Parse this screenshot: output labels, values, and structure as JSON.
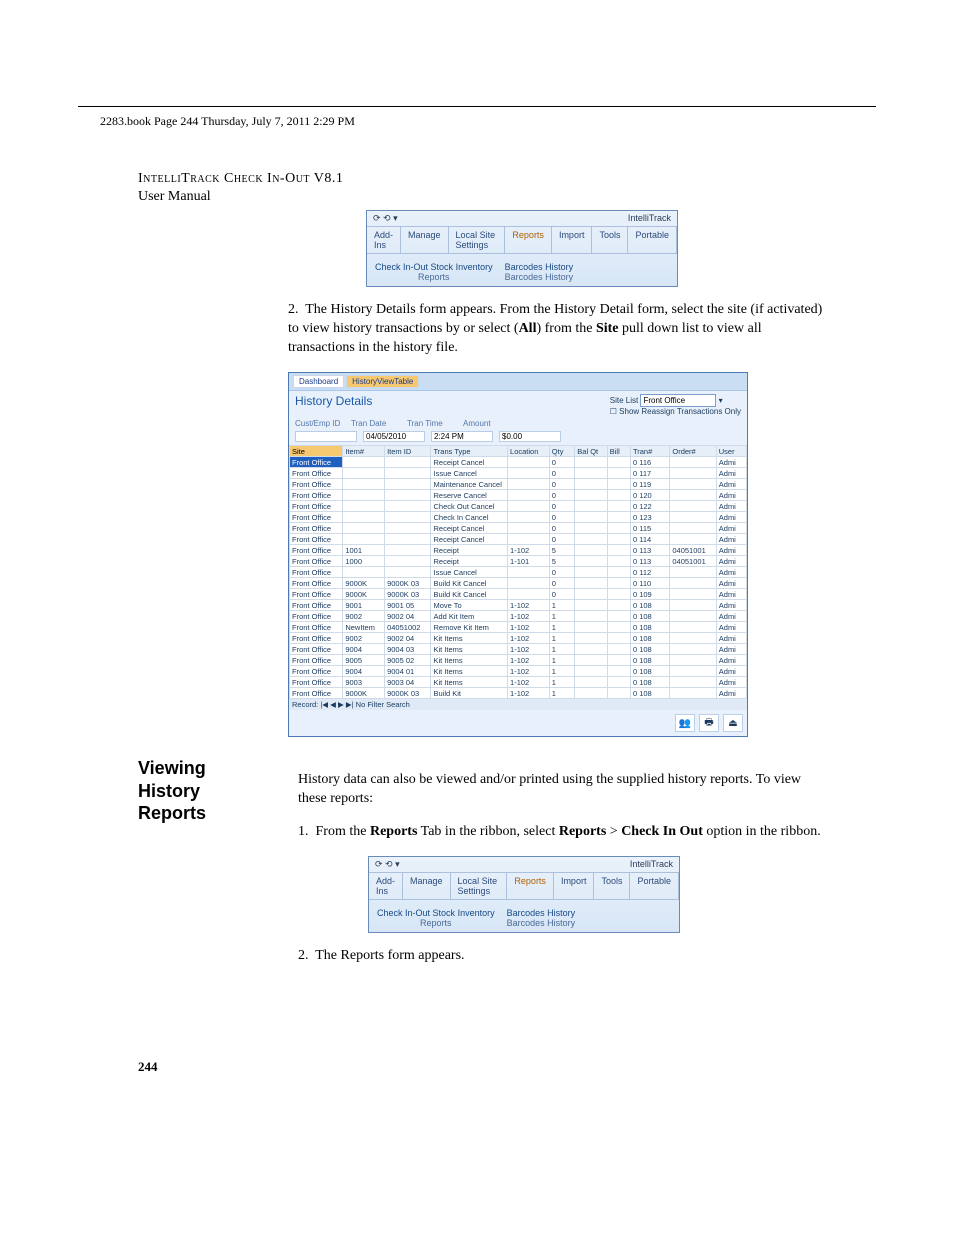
{
  "meta": {
    "book_line": "2283.book  Page 244  Thursday, July 7, 2011  2:29 PM"
  },
  "header": {
    "product": "IntelliTrack Check In-Out V8.1",
    "subtitle": "User Manual"
  },
  "page_number": "244",
  "ribbon": {
    "app_title": "IntelliTrack",
    "tabs": [
      "Add-Ins",
      "Manage",
      "Local Site Settings",
      "Reports",
      "Import",
      "Tools",
      "Portable"
    ],
    "groups": {
      "g1": [
        "Check In-Out",
        "Stock",
        "Inventory"
      ],
      "g2": [
        "Barcodes",
        "History"
      ],
      "g3": [
        "Reports"
      ],
      "g4": [
        "Barcodes",
        "History"
      ]
    }
  },
  "step2a": {
    "num": "2.",
    "text_before": "The History Details form appears. From the History Detail form, select the site (if activated) to view history transactions by or select (",
    "all_word": "All",
    "text_mid": ") from the ",
    "site_word": "Site",
    "text_after": " pull down list to view all transactions in the history file."
  },
  "history_form": {
    "tab1": "Dashboard",
    "tab2": "HistoryViewTable",
    "title": "History Details",
    "site_list_label": "Site List",
    "site_list_value": "Front Office",
    "show_reassign": "Show Reassign Transactions Only",
    "fields": {
      "cust": "Cust/Emp ID",
      "trandate": "Tran Date",
      "trandate_v": "04/05/2010",
      "trantime": "Tran Time",
      "trantime_v": "2:24 PM",
      "amount": "Amount",
      "amount_v": "$0.00"
    },
    "columns": [
      "Site",
      "Item#",
      "Item ID",
      "Trans Type",
      "Location",
      "Qty",
      "Bal Qt",
      "Bill",
      "Tran#",
      "Order#",
      "User"
    ],
    "rows": [
      [
        "Front Office",
        "",
        "",
        "Receipt Cancel",
        "",
        "0",
        "",
        "",
        "0 116",
        "",
        "Admi"
      ],
      [
        "Front Office",
        "",
        "",
        "Issue Cancel",
        "",
        "0",
        "",
        "",
        "0 117",
        "",
        "Admi"
      ],
      [
        "Front Office",
        "",
        "",
        "Maintenance Cancel",
        "",
        "0",
        "",
        "",
        "0 119",
        "",
        "Admi"
      ],
      [
        "Front Office",
        "",
        "",
        "Reserve Cancel",
        "",
        "0",
        "",
        "",
        "0 120",
        "",
        "Admi"
      ],
      [
        "Front Office",
        "",
        "",
        "Check Out Cancel",
        "",
        "0",
        "",
        "",
        "0 122",
        "",
        "Admi"
      ],
      [
        "Front Office",
        "",
        "",
        "Check In Cancel",
        "",
        "0",
        "",
        "",
        "0 123",
        "",
        "Admi"
      ],
      [
        "Front Office",
        "",
        "",
        "Receipt Cancel",
        "",
        "0",
        "",
        "",
        "0 115",
        "",
        "Admi"
      ],
      [
        "Front Office",
        "",
        "",
        "Receipt Cancel",
        "",
        "0",
        "",
        "",
        "0 114",
        "",
        "Admi"
      ],
      [
        "Front Office",
        "1001",
        "",
        "Receipt",
        "1-102",
        "5",
        "",
        "",
        "0 113",
        "04051001",
        "Admi"
      ],
      [
        "Front Office",
        "1000",
        "",
        "Receipt",
        "1-101",
        "5",
        "",
        "",
        "0 113",
        "04051001",
        "Admi"
      ],
      [
        "Front Office",
        "",
        "",
        "Issue Cancel",
        "",
        "0",
        "",
        "",
        "0 112",
        "",
        "Admi"
      ],
      [
        "Front Office",
        "9000K",
        "9000K 03",
        "Build Kit Cancel",
        "",
        "0",
        "",
        "",
        "0 110",
        "",
        "Admi"
      ],
      [
        "Front Office",
        "9000K",
        "9000K 03",
        "Build Kit Cancel",
        "",
        "0",
        "",
        "",
        "0 109",
        "",
        "Admi"
      ],
      [
        "Front Office",
        "9001",
        "9001 05",
        "Move To",
        "1-102",
        "1",
        "",
        "",
        "0 108",
        "",
        "Admi"
      ],
      [
        "Front Office",
        "9002",
        "9002 04",
        "Add Kit Item",
        "1-102",
        "1",
        "",
        "",
        "0 108",
        "",
        "Admi"
      ],
      [
        "Front Office",
        "NewItem",
        "04051002",
        "Remove Kit Item",
        "1-102",
        "1",
        "",
        "",
        "0 108",
        "",
        "Admi"
      ],
      [
        "Front Office",
        "9002",
        "9002 04",
        "Kit Items",
        "1-102",
        "1",
        "",
        "",
        "0 108",
        "",
        "Admi"
      ],
      [
        "Front Office",
        "9004",
        "9004 03",
        "Kit Items",
        "1-102",
        "1",
        "",
        "",
        "0 108",
        "",
        "Admi"
      ],
      [
        "Front Office",
        "9005",
        "9005 02",
        "Kit Items",
        "1-102",
        "1",
        "",
        "",
        "0 108",
        "",
        "Admi"
      ],
      [
        "Front Office",
        "9004",
        "9004 01",
        "Kit Items",
        "1-102",
        "1",
        "",
        "",
        "0 108",
        "",
        "Admi"
      ],
      [
        "Front Office",
        "9003",
        "9003 04",
        "Kit Items",
        "1-102",
        "1",
        "",
        "",
        "0 108",
        "",
        "Admi"
      ],
      [
        "Front Office",
        "9000K",
        "9000K 03",
        "Build Kit",
        "1-102",
        "1",
        "",
        "",
        "0 108",
        "",
        "Admi"
      ]
    ],
    "record_label": "Record:  |◀  ◀  ▶  ▶|   No Filter   Search"
  },
  "section_heading": "Viewing History Reports",
  "section_intro": "History data can also be viewed and/or printed using the supplied history reports. To view these reports:",
  "step1b": {
    "num": "1.",
    "pre": "From the ",
    "reports_tab": "Reports",
    "mid1": " Tab in the ribbon, select ",
    "reports2": "Reports",
    "gt": " > ",
    "cio": "Check In Out",
    "post": " option in the ribbon."
  },
  "step2b": {
    "num": "2.",
    "text": "The Reports form appears."
  }
}
